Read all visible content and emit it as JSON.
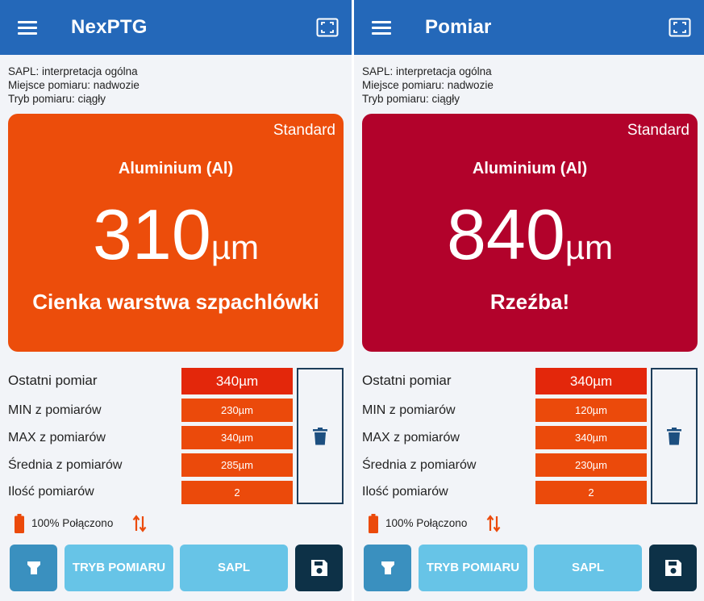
{
  "colors": {
    "appbar": "#2468b9",
    "card_left": "#ec4d0b",
    "card_right": "#b2022b",
    "value_cell": "#eb4a0b",
    "last_value_cell": "#e3270b",
    "button_light": "#67c4e7",
    "button_torch": "#3a90bf",
    "button_dark": "#0d3147"
  },
  "icons": {
    "menu": "hamburger-icon",
    "fullscreen": "fullscreen-icon",
    "trash": "trash-icon",
    "battery": "battery-icon",
    "connection": "sync-arrows-icon",
    "torch": "flashlight-icon",
    "save": "floppy-disk-icon"
  },
  "screens": [
    {
      "appbar": {
        "title": "NexPTG"
      },
      "info": {
        "sapl": "SAPL: interpretacja ogólna",
        "location": "Miejsce pomiaru: nadwozie",
        "mode": "Tryb pomiaru: ciągły"
      },
      "card": {
        "mode": "Standard",
        "material": "Aluminium (Al)",
        "value": "310",
        "unit": "µm",
        "status": "Cienka warstwa szpachlówki"
      },
      "stats": [
        {
          "label": "Ostatni pomiar",
          "value": "340µm"
        },
        {
          "label": "MIN z pomiarów",
          "value": "230µm"
        },
        {
          "label": "MAX z pomiarów",
          "value": "340µm"
        },
        {
          "label": "Średnia z pomiarów",
          "value": "285µm"
        },
        {
          "label": "Ilość pomiarów",
          "value": "2"
        }
      ],
      "status": {
        "text": "100% Połączono"
      },
      "buttons": {
        "mode": "TRYB POMIARU",
        "sapl": "SAPL"
      }
    },
    {
      "appbar": {
        "title": "Pomiar"
      },
      "info": {
        "sapl": "SAPL: interpretacja ogólna",
        "location": "Miejsce pomiaru: nadwozie",
        "mode": "Tryb pomiaru: ciągły"
      },
      "card": {
        "mode": "Standard",
        "material": "Aluminium (Al)",
        "value": "840",
        "unit": "µm",
        "status": "Rzeźba!"
      },
      "stats": [
        {
          "label": "Ostatni pomiar",
          "value": "340µm"
        },
        {
          "label": "MIN z pomiarów",
          "value": "120µm"
        },
        {
          "label": "MAX z pomiarów",
          "value": "340µm"
        },
        {
          "label": "Średnia z pomiarów",
          "value": "230µm"
        },
        {
          "label": "Ilość pomiarów",
          "value": "2"
        }
      ],
      "status": {
        "text": "100% Połączono"
      },
      "buttons": {
        "mode": "TRYB POMIARU",
        "sapl": "SAPL"
      }
    }
  ]
}
